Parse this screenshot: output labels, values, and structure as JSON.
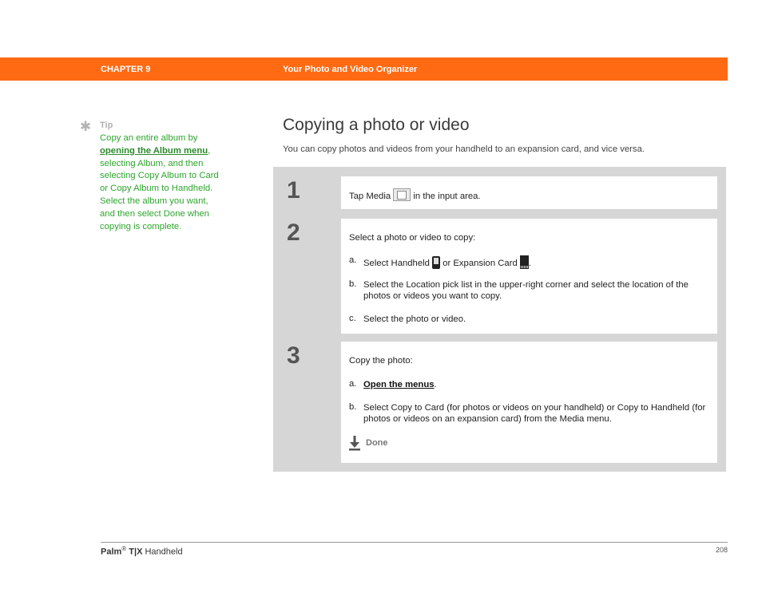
{
  "header": {
    "chapter": "CHAPTER 9",
    "section": "Your Photo and Video Organizer",
    "bar_color": "#ff6a13"
  },
  "tip": {
    "icon": "asterisk-icon",
    "label": "Tip",
    "text_before": "Copy an entire album by ",
    "link_text": "opening the Album menu",
    "text_after": ", selecting Album, and then selecting Copy Album to Card or Copy Album to Handheld. Select the album you want, and then select Done when copying is complete.",
    "color": "#2ca52c"
  },
  "page": {
    "title": "Copying a photo or video",
    "intro": "You can copy photos and videos from your handheld to an expansion card, and vice versa."
  },
  "steps": [
    {
      "number": "1",
      "text_before": "Tap Media",
      "icon": "media-icon",
      "text_after": "in the input area."
    },
    {
      "number": "2",
      "intro": "Select a photo or video to copy:",
      "items": [
        {
          "marker": "a.",
          "text_before": "Select Handheld",
          "icon1": "handheld-icon",
          "text_mid": "or Expansion Card",
          "icon2": "expansion-card-icon",
          "text_after": "."
        },
        {
          "marker": "b.",
          "text": "Select the Location pick list in the upper-right corner and select the location of the photos or videos you want to copy."
        },
        {
          "marker": "c.",
          "text": "Select the photo or video."
        }
      ]
    },
    {
      "number": "3",
      "intro": "Copy the photo:",
      "items": [
        {
          "marker": "a.",
          "link_text": "Open the menus",
          "text_after": "."
        },
        {
          "marker": "b.",
          "text": "Select Copy to Card (for photos or videos on your handheld) or Copy to Handheld (for photos or videos on an expansion card) from the Media menu."
        }
      ],
      "done_icon": "done-arrow-icon",
      "done_label": "Done"
    }
  ],
  "footer": {
    "brand": "Palm",
    "registered": "®",
    "model": "T|X",
    "product": "Handheld",
    "page_number": "208"
  }
}
